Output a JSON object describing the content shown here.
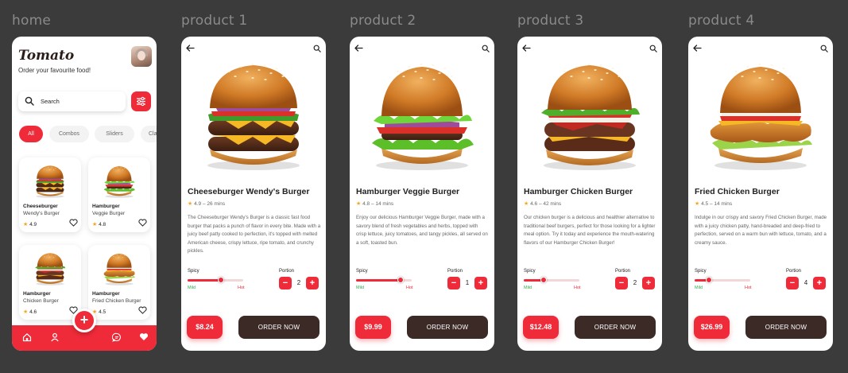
{
  "frames": {
    "home": "home",
    "product1": "product 1",
    "product2": "product 2",
    "product3": "product 3",
    "product4": "product 4"
  },
  "home": {
    "logo": "Tomato",
    "tagline": "Order your favourite food!",
    "search_placeholder": "Search",
    "chips": [
      "All",
      "Combos",
      "Sliders",
      "Cla"
    ],
    "active_chip": "All",
    "cards": [
      {
        "name1": "Cheeseburger",
        "name2": "Wendy's Burger",
        "rating": "4.9"
      },
      {
        "name1": "Hamburger",
        "name2": "Veggie Burger",
        "rating": "4.8"
      },
      {
        "name1": "Hamburger",
        "name2": "Chicken Burger",
        "rating": "4.6"
      },
      {
        "name1": "Hamburger",
        "name2": "Fried Chicken Burger",
        "rating": "4.5"
      }
    ],
    "fab": "+",
    "nav_icons": [
      "home-icon",
      "user-icon",
      "chat-icon",
      "heart-icon"
    ]
  },
  "products": [
    {
      "title": "Cheeseburger Wendy's Burger",
      "rating": "4.9",
      "time": "26 mins",
      "description": "The Cheeseburger Wendy's Burger is a classic fast food burger that packs a punch of flavor in every bite. Made with a juicy beef patty cooked to perfection, it's topped with melted American cheese, crispy lettuce, ripe tomato, and crunchy pickles.",
      "spicy_label": "Spicy",
      "mild": "Mild",
      "hot": "Hot",
      "spicy_level": 0.6,
      "portion_label": "Portion",
      "portion": "2",
      "price": "$8.24",
      "order": "ORDER NOW"
    },
    {
      "title": "Hamburger Veggie Burger",
      "rating": "4.8",
      "time": "14 mins",
      "description": "Enjoy our delicious Hamburger Veggie Burger, made with a savory blend of fresh vegetables and herbs, topped with crisp lettuce, juicy tomatoes, and tangy pickles, all served on a soft, toasted bun.",
      "spicy_label": "Spicy",
      "mild": "Mild",
      "hot": "Hot",
      "spicy_level": 0.8,
      "portion_label": "Portion",
      "portion": "1",
      "price": "$9.99",
      "order": "ORDER NOW"
    },
    {
      "title": "Hamburger Chicken Burger",
      "rating": "4.6",
      "time": "42 mins",
      "description": "Our chicken burger is a delicious and healthier alternative to traditional beef burgers, perfect for those looking for a lighter meal option. Try it today and experience the mouth-watering flavors of our Hamburger Chicken Burger!",
      "spicy_label": "Spicy",
      "mild": "Mild",
      "hot": "Hot",
      "spicy_level": 0.35,
      "portion_label": "Portion",
      "portion": "2",
      "price": "$12.48",
      "order": "ORDER NOW"
    },
    {
      "title": "Fried Chicken Burger",
      "rating": "4.5",
      "time": "14 mins",
      "description": "Indulge in our crispy and savory Fried Chicken Burger, made with a juicy chicken patty, hand-breaded and deep-fried to perfection, served on a warm bun with lettuce, tomato, and a creamy sauce.",
      "spicy_label": "Spicy",
      "mild": "Mild",
      "hot": "Hot",
      "spicy_level": 0.25,
      "portion_label": "Portion",
      "portion": "4",
      "price": "$26.99",
      "order": "ORDER NOW"
    }
  ],
  "colors": {
    "background": "#3b3b3b",
    "accent": "#ef2a39",
    "dark_button": "#3c2a27",
    "star": "#f5a623"
  }
}
